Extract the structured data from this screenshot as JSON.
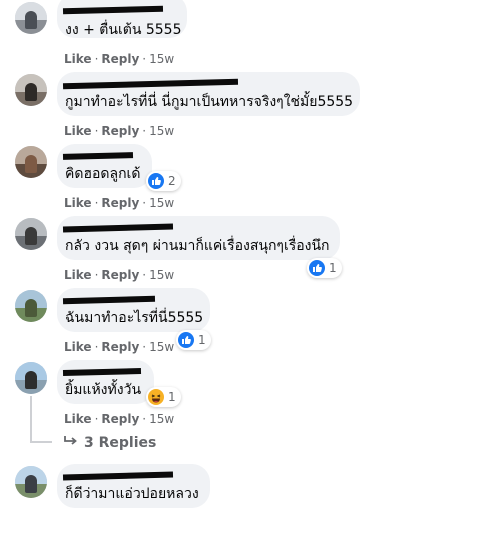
{
  "actions": {
    "like": "Like",
    "reply": "Reply",
    "separator": "·"
  },
  "comments": [
    {
      "text": "งง + ตื่นเต้น 5555",
      "time": "15w",
      "reaction": null
    },
    {
      "text": "กูมาทำอะไรที่นี่ นี่กูมาเป็นทหารจริงๆใช่มั้ย5555",
      "time": "15w",
      "reaction": null
    },
    {
      "text": "คิดฮอดลูกเด้",
      "time": "15w",
      "reaction": {
        "type": "like",
        "count": "2"
      }
    },
    {
      "text": "กลัว งวน สุดๆ ผ่านมาก็แค่เรื่องสนุกๆเรื่องนึก",
      "time": "15w",
      "reaction": {
        "type": "like",
        "count": "1"
      }
    },
    {
      "text": "ฉันมาทำอะไรที่นี่5555",
      "time": "15w",
      "reaction": {
        "type": "like",
        "count": "1"
      }
    },
    {
      "text": "ยิ้มแห้งทั้งวัน",
      "time": "15w",
      "reaction": {
        "type": "haha",
        "count": "1"
      }
    },
    {
      "text": "ก็ดีว่ามาแอ่วปอยหลวง",
      "time": "",
      "reaction": null
    }
  ],
  "replies": {
    "label": "3 Replies",
    "icon": "reply-arrow-icon"
  },
  "colors": {
    "bubble": "#f0f2f5",
    "like": "#1877f2",
    "haha": "#f7b125",
    "meta": "#65676b"
  }
}
